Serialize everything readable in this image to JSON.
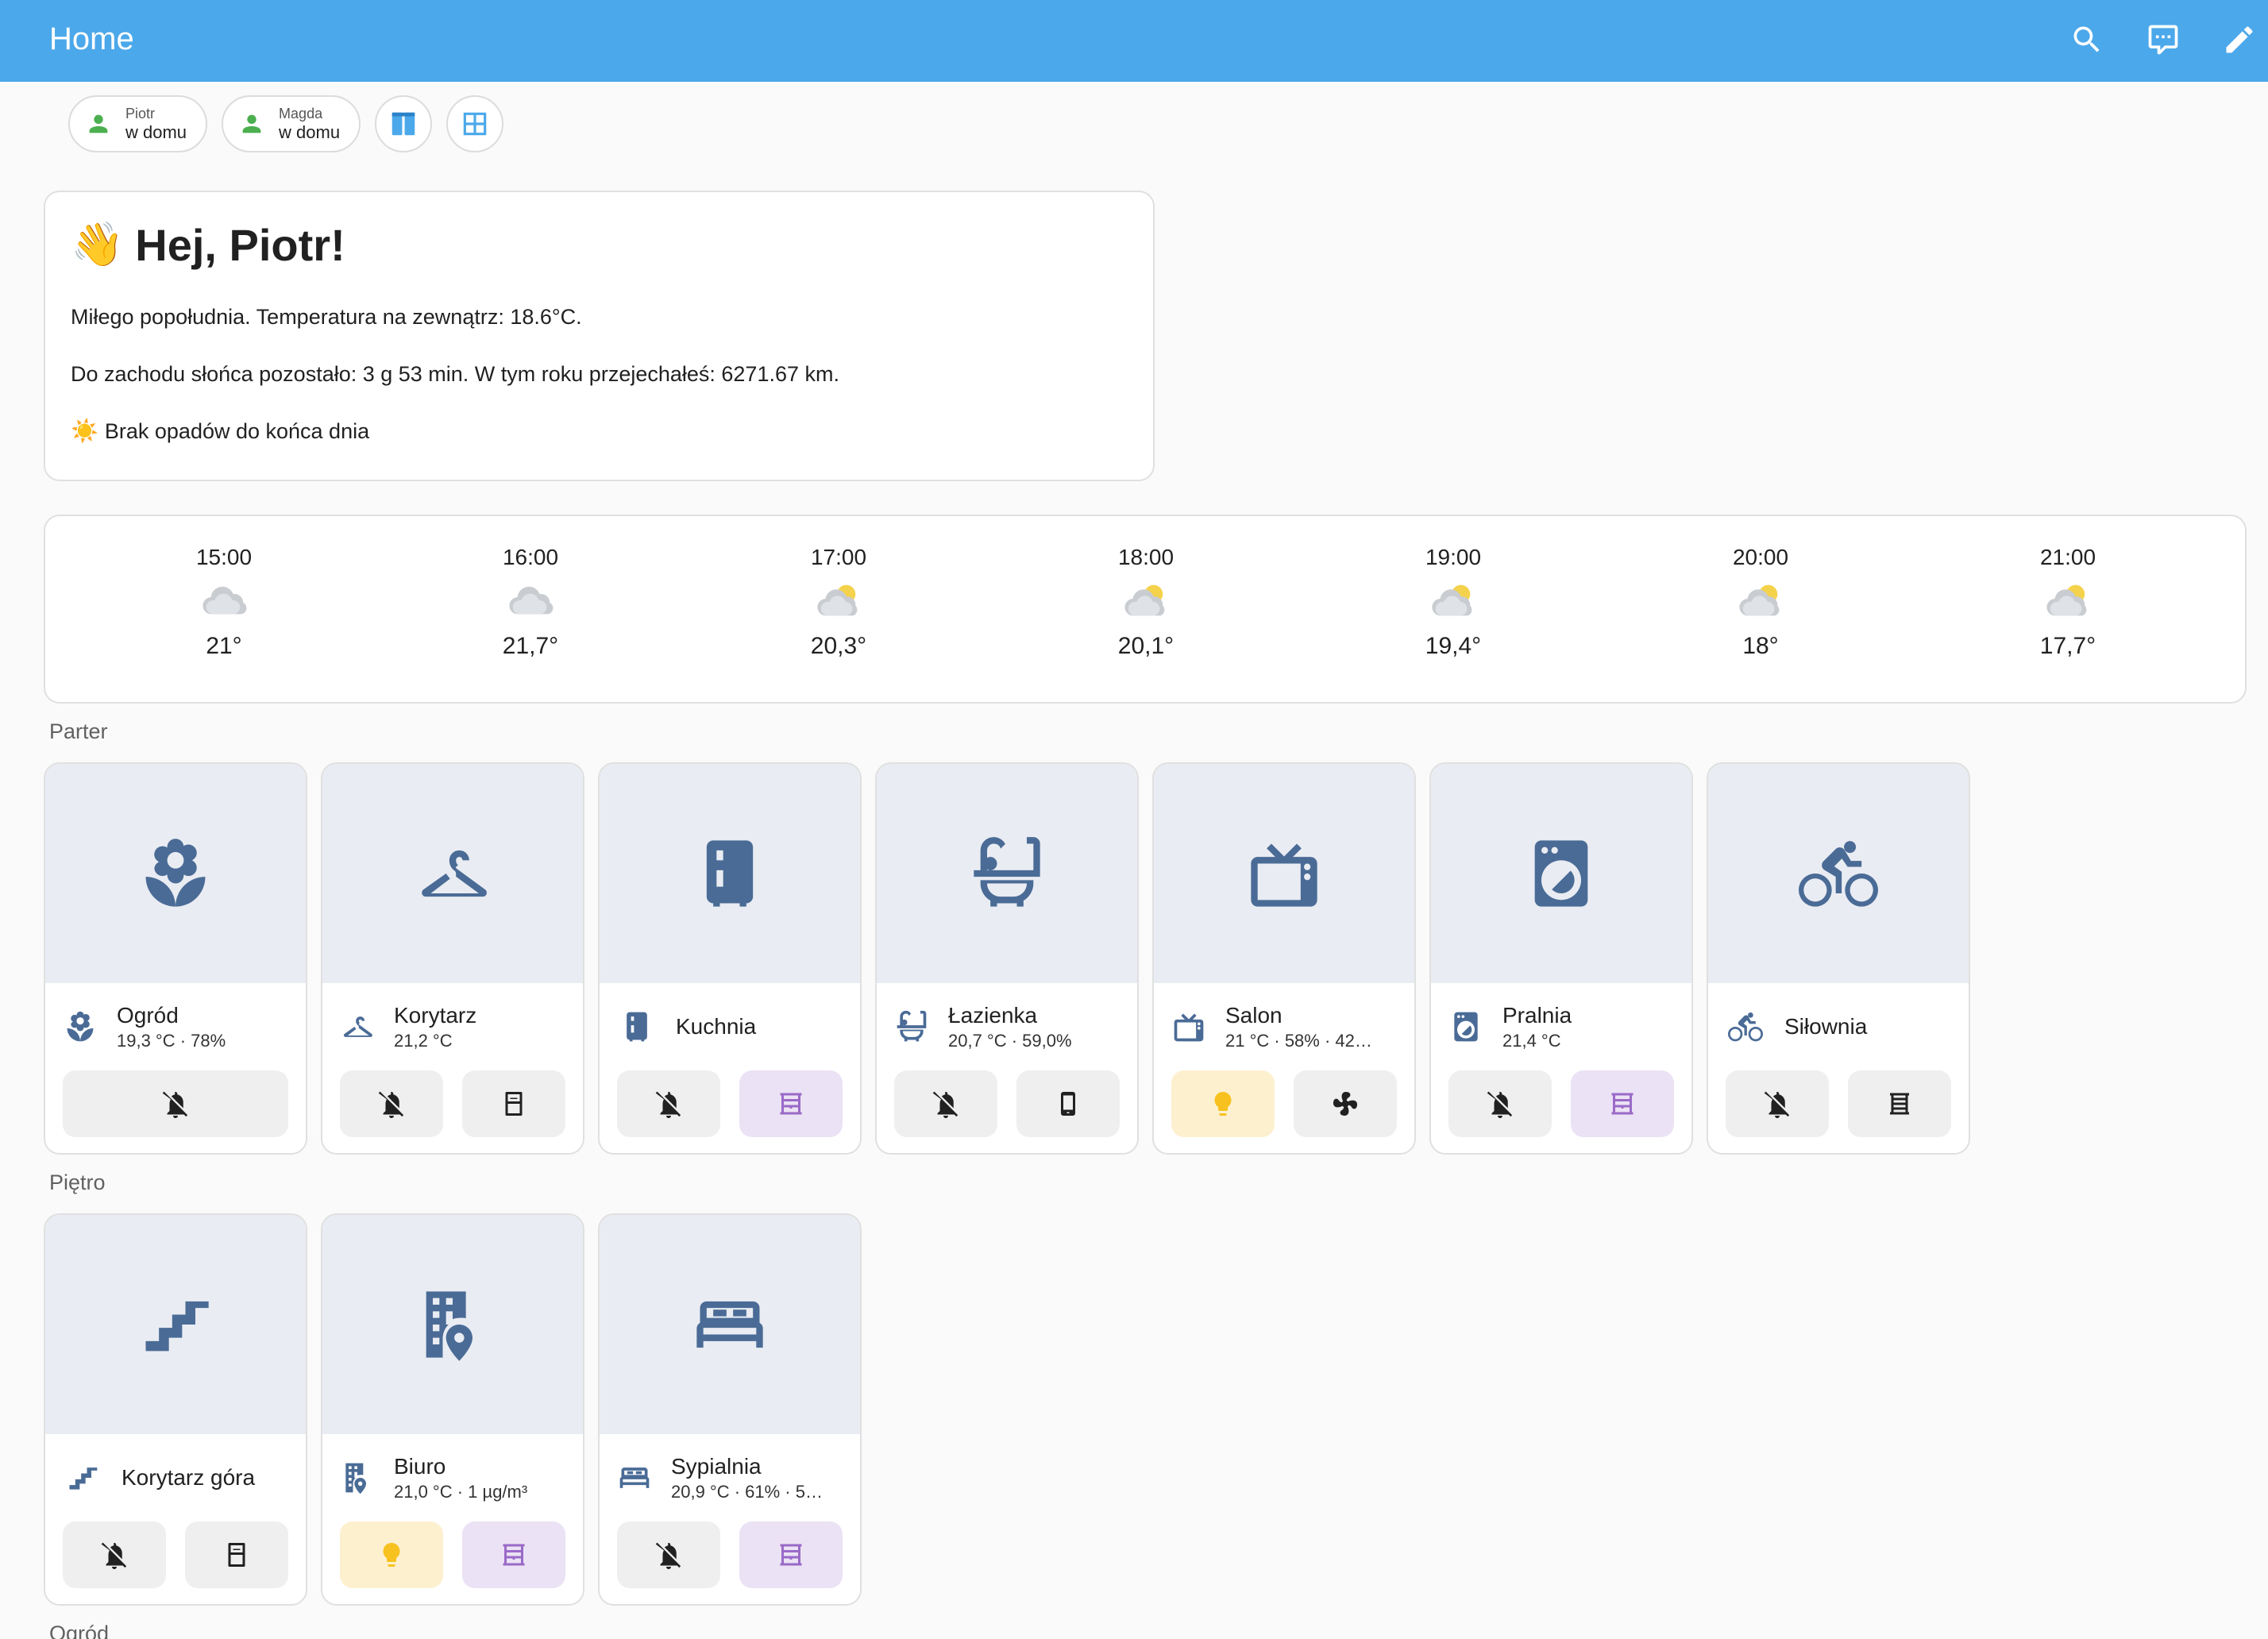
{
  "header": {
    "title": "Home"
  },
  "badges": [
    {
      "name": "Piotr",
      "state": "w domu"
    },
    {
      "name": "Magda",
      "state": "w domu"
    }
  ],
  "greeting": {
    "title": "Hej, Piotr!",
    "line1": "Miłego popołudnia. Temperatura na zewnątrz: 18.6°C.",
    "line2": "Do zachodu słońca pozostało: 3 g 53 min. W tym roku przejechałeś: 6271.67 km.",
    "line3": "Brak opadów do końca dnia"
  },
  "forecast": [
    {
      "time": "15:00",
      "temp": "21°",
      "icon": "cloudy"
    },
    {
      "time": "16:00",
      "temp": "21,7°",
      "icon": "cloudy"
    },
    {
      "time": "17:00",
      "temp": "20,3°",
      "icon": "partly-cloudy"
    },
    {
      "time": "18:00",
      "temp": "20,1°",
      "icon": "partly-cloudy"
    },
    {
      "time": "19:00",
      "temp": "19,4°",
      "icon": "partly-cloudy"
    },
    {
      "time": "20:00",
      "temp": "18°",
      "icon": "partly-cloudy"
    },
    {
      "time": "21:00",
      "temp": "17,7°",
      "icon": "partly-cloudy"
    }
  ],
  "sections": {
    "parter": "Parter",
    "pietro": "Piętro",
    "ogrod": "Ogród"
  },
  "areas": {
    "ogrod": {
      "name": "Ogród",
      "stats": "19,3 °C · 78%"
    },
    "korytarz": {
      "name": "Korytarz",
      "stats": "21,2 °C"
    },
    "kuchnia": {
      "name": "Kuchnia",
      "stats": ""
    },
    "lazienka": {
      "name": "Łazienka",
      "stats": "20,7 °C · 59,0%"
    },
    "salon": {
      "name": "Salon",
      "stats": "21 °C · 58% · 42…"
    },
    "pralnia": {
      "name": "Pralnia",
      "stats": "21,4 °C"
    },
    "silownia": {
      "name": "Siłownia",
      "stats": ""
    },
    "korytarz_gora": {
      "name": "Korytarz góra",
      "stats": ""
    },
    "biuro": {
      "name": "Biuro",
      "stats": "21,0 °C · 1 µg/m³"
    },
    "sypialnia": {
      "name": "Sypialnia",
      "stats": "20,9 °C · 61% · 5…"
    }
  },
  "colors": {
    "header": "#4ba8ea",
    "area_icon": "#4a6b96",
    "light_on": "#f7c21f",
    "cover_open": "#9a6ac8",
    "person_home": "#4caf50"
  }
}
